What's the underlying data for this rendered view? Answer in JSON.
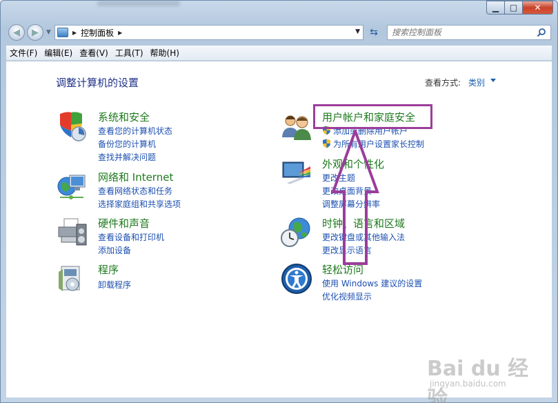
{
  "window": {
    "buttons": {
      "minimize": "▁",
      "maximize": "□",
      "close": "✕"
    }
  },
  "address": {
    "breadcrumb": "控制面板",
    "search_placeholder": "搜索控制面板"
  },
  "menu": [
    "文件(F)",
    "编辑(E)",
    "查看(V)",
    "工具(T)",
    "帮助(H)"
  ],
  "content": {
    "title": "调整计算机的设置",
    "view_by_label": "查看方式:",
    "view_by_value": "类别"
  },
  "categories": {
    "system": {
      "title": "系统和安全",
      "links": [
        "查看您的计算机状态",
        "备份您的计算机",
        "查找并解决问题"
      ]
    },
    "network": {
      "title": "网络和 Internet",
      "links": [
        "查看网络状态和任务",
        "选择家庭组和共享选项"
      ]
    },
    "hardware": {
      "title": "硬件和声音",
      "links": [
        "查看设备和打印机",
        "添加设备"
      ]
    },
    "programs": {
      "title": "程序",
      "links": [
        "卸载程序"
      ]
    },
    "users": {
      "title": "用户帐户和家庭安全",
      "links": [
        "添加或删除用户帐户",
        "为所有用户设置家长控制"
      ]
    },
    "appearance": {
      "title": "外观和个性化",
      "links": [
        "更改主题",
        "更改桌面背景",
        "调整屏幕分辨率"
      ]
    },
    "clock": {
      "title": "时钟、语言和区域",
      "links": [
        "更改键盘或其他输入法",
        "更改显示语言"
      ]
    },
    "ease": {
      "title": "轻松访问",
      "links": [
        "使用 Windows 建议的设置",
        "优化视频显示"
      ]
    }
  },
  "watermark": {
    "logo": "Bai du 经验",
    "url": "jingyan.baidu.com"
  },
  "colors": {
    "category_title": "#1d7a1d",
    "link": "#1c4fb0",
    "page_title": "#1e3287",
    "annotation": "#9b3d9b"
  }
}
